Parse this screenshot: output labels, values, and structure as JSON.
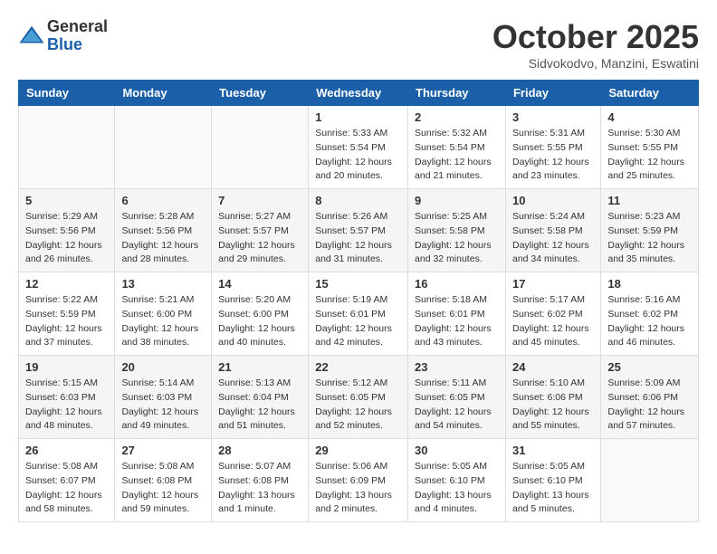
{
  "header": {
    "logo_general": "General",
    "logo_blue": "Blue",
    "month_title": "October 2025",
    "location": "Sidvokodvo, Manzini, Eswatini"
  },
  "days_of_week": [
    "Sunday",
    "Monday",
    "Tuesday",
    "Wednesday",
    "Thursday",
    "Friday",
    "Saturday"
  ],
  "weeks": [
    [
      {
        "day": "",
        "sunrise": "",
        "sunset": "",
        "daylight": ""
      },
      {
        "day": "",
        "sunrise": "",
        "sunset": "",
        "daylight": ""
      },
      {
        "day": "",
        "sunrise": "",
        "sunset": "",
        "daylight": ""
      },
      {
        "day": "1",
        "sunrise": "Sunrise: 5:33 AM",
        "sunset": "Sunset: 5:54 PM",
        "daylight": "Daylight: 12 hours and 20 minutes."
      },
      {
        "day": "2",
        "sunrise": "Sunrise: 5:32 AM",
        "sunset": "Sunset: 5:54 PM",
        "daylight": "Daylight: 12 hours and 21 minutes."
      },
      {
        "day": "3",
        "sunrise": "Sunrise: 5:31 AM",
        "sunset": "Sunset: 5:55 PM",
        "daylight": "Daylight: 12 hours and 23 minutes."
      },
      {
        "day": "4",
        "sunrise": "Sunrise: 5:30 AM",
        "sunset": "Sunset: 5:55 PM",
        "daylight": "Daylight: 12 hours and 25 minutes."
      }
    ],
    [
      {
        "day": "5",
        "sunrise": "Sunrise: 5:29 AM",
        "sunset": "Sunset: 5:56 PM",
        "daylight": "Daylight: 12 hours and 26 minutes."
      },
      {
        "day": "6",
        "sunrise": "Sunrise: 5:28 AM",
        "sunset": "Sunset: 5:56 PM",
        "daylight": "Daylight: 12 hours and 28 minutes."
      },
      {
        "day": "7",
        "sunrise": "Sunrise: 5:27 AM",
        "sunset": "Sunset: 5:57 PM",
        "daylight": "Daylight: 12 hours and 29 minutes."
      },
      {
        "day": "8",
        "sunrise": "Sunrise: 5:26 AM",
        "sunset": "Sunset: 5:57 PM",
        "daylight": "Daylight: 12 hours and 31 minutes."
      },
      {
        "day": "9",
        "sunrise": "Sunrise: 5:25 AM",
        "sunset": "Sunset: 5:58 PM",
        "daylight": "Daylight: 12 hours and 32 minutes."
      },
      {
        "day": "10",
        "sunrise": "Sunrise: 5:24 AM",
        "sunset": "Sunset: 5:58 PM",
        "daylight": "Daylight: 12 hours and 34 minutes."
      },
      {
        "day": "11",
        "sunrise": "Sunrise: 5:23 AM",
        "sunset": "Sunset: 5:59 PM",
        "daylight": "Daylight: 12 hours and 35 minutes."
      }
    ],
    [
      {
        "day": "12",
        "sunrise": "Sunrise: 5:22 AM",
        "sunset": "Sunset: 5:59 PM",
        "daylight": "Daylight: 12 hours and 37 minutes."
      },
      {
        "day": "13",
        "sunrise": "Sunrise: 5:21 AM",
        "sunset": "Sunset: 6:00 PM",
        "daylight": "Daylight: 12 hours and 38 minutes."
      },
      {
        "day": "14",
        "sunrise": "Sunrise: 5:20 AM",
        "sunset": "Sunset: 6:00 PM",
        "daylight": "Daylight: 12 hours and 40 minutes."
      },
      {
        "day": "15",
        "sunrise": "Sunrise: 5:19 AM",
        "sunset": "Sunset: 6:01 PM",
        "daylight": "Daylight: 12 hours and 42 minutes."
      },
      {
        "day": "16",
        "sunrise": "Sunrise: 5:18 AM",
        "sunset": "Sunset: 6:01 PM",
        "daylight": "Daylight: 12 hours and 43 minutes."
      },
      {
        "day": "17",
        "sunrise": "Sunrise: 5:17 AM",
        "sunset": "Sunset: 6:02 PM",
        "daylight": "Daylight: 12 hours and 45 minutes."
      },
      {
        "day": "18",
        "sunrise": "Sunrise: 5:16 AM",
        "sunset": "Sunset: 6:02 PM",
        "daylight": "Daylight: 12 hours and 46 minutes."
      }
    ],
    [
      {
        "day": "19",
        "sunrise": "Sunrise: 5:15 AM",
        "sunset": "Sunset: 6:03 PM",
        "daylight": "Daylight: 12 hours and 48 minutes."
      },
      {
        "day": "20",
        "sunrise": "Sunrise: 5:14 AM",
        "sunset": "Sunset: 6:03 PM",
        "daylight": "Daylight: 12 hours and 49 minutes."
      },
      {
        "day": "21",
        "sunrise": "Sunrise: 5:13 AM",
        "sunset": "Sunset: 6:04 PM",
        "daylight": "Daylight: 12 hours and 51 minutes."
      },
      {
        "day": "22",
        "sunrise": "Sunrise: 5:12 AM",
        "sunset": "Sunset: 6:05 PM",
        "daylight": "Daylight: 12 hours and 52 minutes."
      },
      {
        "day": "23",
        "sunrise": "Sunrise: 5:11 AM",
        "sunset": "Sunset: 6:05 PM",
        "daylight": "Daylight: 12 hours and 54 minutes."
      },
      {
        "day": "24",
        "sunrise": "Sunrise: 5:10 AM",
        "sunset": "Sunset: 6:06 PM",
        "daylight": "Daylight: 12 hours and 55 minutes."
      },
      {
        "day": "25",
        "sunrise": "Sunrise: 5:09 AM",
        "sunset": "Sunset: 6:06 PM",
        "daylight": "Daylight: 12 hours and 57 minutes."
      }
    ],
    [
      {
        "day": "26",
        "sunrise": "Sunrise: 5:08 AM",
        "sunset": "Sunset: 6:07 PM",
        "daylight": "Daylight: 12 hours and 58 minutes."
      },
      {
        "day": "27",
        "sunrise": "Sunrise: 5:08 AM",
        "sunset": "Sunset: 6:08 PM",
        "daylight": "Daylight: 12 hours and 59 minutes."
      },
      {
        "day": "28",
        "sunrise": "Sunrise: 5:07 AM",
        "sunset": "Sunset: 6:08 PM",
        "daylight": "Daylight: 13 hours and 1 minute."
      },
      {
        "day": "29",
        "sunrise": "Sunrise: 5:06 AM",
        "sunset": "Sunset: 6:09 PM",
        "daylight": "Daylight: 13 hours and 2 minutes."
      },
      {
        "day": "30",
        "sunrise": "Sunrise: 5:05 AM",
        "sunset": "Sunset: 6:10 PM",
        "daylight": "Daylight: 13 hours and 4 minutes."
      },
      {
        "day": "31",
        "sunrise": "Sunrise: 5:05 AM",
        "sunset": "Sunset: 6:10 PM",
        "daylight": "Daylight: 13 hours and 5 minutes."
      },
      {
        "day": "",
        "sunrise": "",
        "sunset": "",
        "daylight": ""
      }
    ]
  ]
}
